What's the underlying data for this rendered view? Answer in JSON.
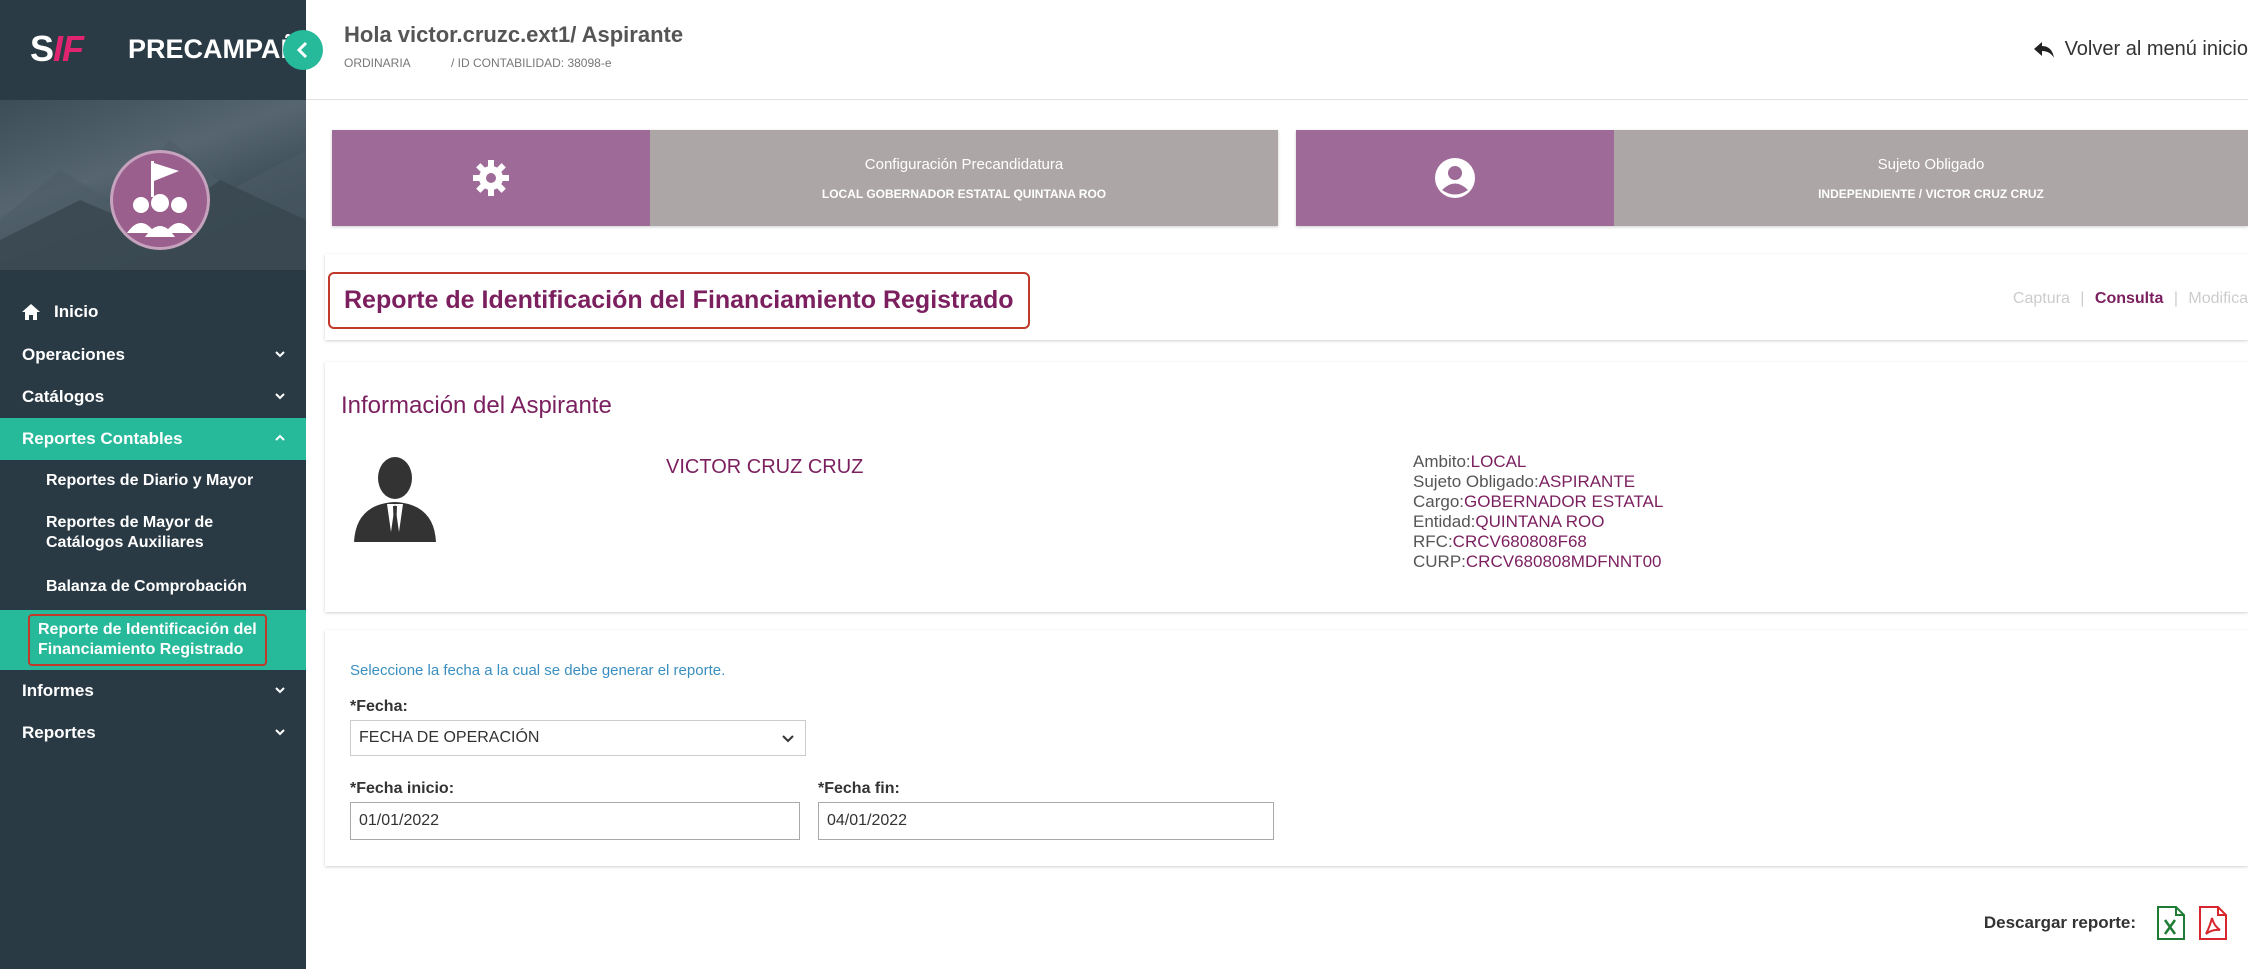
{
  "brand": {
    "logo_s": "S",
    "logo_if": "IF",
    "title": "PRECAMPAÑA"
  },
  "header": {
    "greeting": "Hola victor.cruzc.ext1/ Aspirante",
    "process": "ORDINARIA",
    "accounting_id": "/ ID CONTABILIDAD: 38098-e",
    "back_link": "Volver al menú inicio"
  },
  "cards": [
    {
      "label": "Configuración Precandidatura",
      "value": "LOCAL GOBERNADOR ESTATAL QUINTANA ROO",
      "icon": "gear-icon"
    },
    {
      "label": "Sujeto Obligado",
      "value": "INDEPENDIENTE / VICTOR CRUZ CRUZ",
      "icon": "user-circle-icon"
    }
  ],
  "sidebar": {
    "items": [
      {
        "label": "Inicio",
        "icon": "home-icon"
      },
      {
        "label": "Operaciones"
      },
      {
        "label": "Catálogos"
      },
      {
        "label": "Reportes Contables"
      },
      {
        "label": "Informes"
      },
      {
        "label": "Reportes"
      }
    ],
    "sub_items": [
      {
        "label": "Reportes de Diario y Mayor"
      },
      {
        "label_line1": "Reportes de Mayor de",
        "label_line2": "Catálogos Auxiliares"
      },
      {
        "label": "Balanza de Comprobación"
      },
      {
        "label_line1": "Reporte de Identificación del",
        "label_line2": "Financiamiento Registrado"
      }
    ]
  },
  "report": {
    "title": "Reporte de Identificación del Financiamiento Registrado",
    "tabs": [
      "Captura",
      "Consulta",
      "Modifica"
    ],
    "tab_sep": "|"
  },
  "aspirant": {
    "section_title": "Información del Aspirante",
    "name": "VICTOR CRUZ CRUZ",
    "ambito_label": "Ambito:",
    "ambito": "LOCAL",
    "sujeto_label": "Sujeto Obligado:",
    "sujeto": "ASPIRANTE",
    "cargo_label": "Cargo:",
    "cargo": "GOBERNADOR ESTATAL",
    "entidad_label": "Entidad:",
    "entidad": "QUINTANA ROO",
    "rfc_label": "RFC:",
    "rfc": "CRCV680808F68",
    "curp_label": "CURP:",
    "curp": "CRCV680808MDFNNT00"
  },
  "form": {
    "hint": "Seleccione la fecha a la cual se debe generar el reporte.",
    "fecha_label": "*Fecha:",
    "fecha_value": "FECHA DE OPERACIÓN",
    "inicio_label": "*Fecha inicio:",
    "inicio_value": "01/01/2022",
    "fin_label": "*Fecha fin:",
    "fin_value": "04/01/2022"
  },
  "download": {
    "label": "Descargar reporte:",
    "excel_icon": "excel-icon",
    "pdf_icon": "pdf-icon"
  },
  "colors": {
    "sidebar": "#2a3a44",
    "accent": "#26b99a",
    "purple": "#9e6b98",
    "title": "#7b1f5f",
    "highlight": "#c0392b"
  }
}
